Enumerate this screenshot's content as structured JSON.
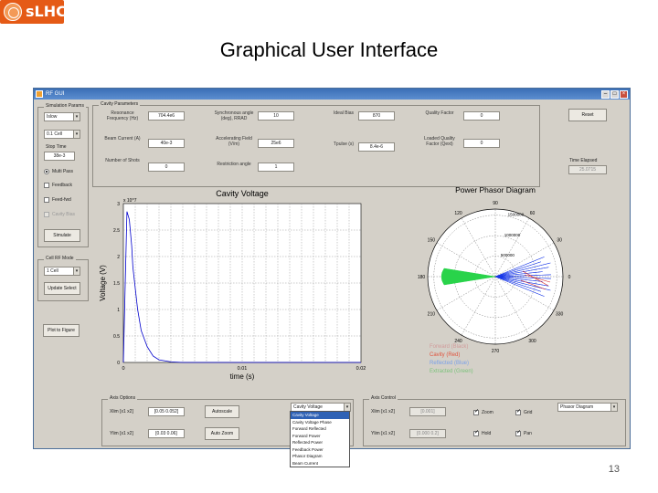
{
  "slide": {
    "logo_text": "sLHC",
    "title": "Graphical User Interface",
    "page_number": "13"
  },
  "window": {
    "title": "RF GUI",
    "sim_params_title": "Simulation Params",
    "sim_select_1": "Islow",
    "sim_select_2": "0.1 Cell",
    "stop_time_label": "Stop Time",
    "stop_time_value": "38e-3",
    "radio_label": "Multi Pass",
    "feedback_label": "Feedback",
    "feedforward_label": "Feed-fwd",
    "disabled_label": "Cavity Bias",
    "simulate_button": "Simulate",
    "cavity_params_title": "Cavity Parameters",
    "fields": [
      {
        "label": "Resonance Frequency (Hz)",
        "value": "704.4e6"
      },
      {
        "label": "Synchronous angle (deg), RRAD",
        "value": "10"
      },
      {
        "label": "Ideal Bias",
        "value": "870"
      },
      {
        "label": "Quality Factor",
        "value": "0"
      },
      {
        "label": "Beam Current (A)",
        "value": "40e-3"
      },
      {
        "label": "Accelerating Field (V/m)",
        "value": "25e6"
      },
      {
        "label": "Tpulse (s)",
        "value": "8.4e-6"
      },
      {
        "label": "Loaded Quality Factor (Qext)",
        "value": "0"
      },
      {
        "label": "Number of Shots",
        "value": "0"
      },
      {
        "label": "Restriction angle",
        "value": "1"
      }
    ],
    "reset_button": "Reset",
    "time_elapsed_label": "Time Elapsed",
    "time_elapsed_value": "25.0715",
    "cell_title": "Cell RF Mode",
    "cell_select": "1 Cell",
    "update_button": "Update Select",
    "plot_button": "Plot to Figure",
    "axes_title": "Axis Options",
    "xaxis_label": "Xlim [x1 x2]",
    "xaxis_value": "[0.05 0.052]",
    "yaxis_label": "Ylim [x1 x2]",
    "yaxis_value": "[0.03 0.06]",
    "autoscale_button": "Autoscale",
    "autozoom_button": "Auto Zoom",
    "dropdown_value": "Cavity Voltage",
    "dropdown_options": [
      "Cavity Voltage",
      "Cavity Voltage Phase",
      "Forward Reflected",
      "Forward Power",
      "Reflected Power",
      "Feedback Power",
      "Phasor Diagram",
      "Beam Current"
    ],
    "axis_control_title": "Axis Control",
    "xctl_label": "Xlim [x1 x2]",
    "xctl_value": "[0.001]",
    "yctl_label": "Ylim [x1 x2]",
    "yctl_value": "[0.000 0.2]",
    "ctl_checks": [
      "Zoom",
      "Grid",
      "Hold",
      "Pan"
    ],
    "right_select": "Phasor Diagram"
  },
  "chart_data": [
    {
      "type": "line",
      "title": "Cavity Voltage",
      "xlabel": "time (s)",
      "ylabel": "Voltage (V)",
      "multiplier_label": "x 10^7",
      "xlim": [
        0,
        0.02
      ],
      "ylim": [
        0,
        3
      ],
      "x_ticks": [
        "0",
        "0.01",
        "0.02"
      ],
      "y_ticks": [
        "0",
        "0.5",
        "1",
        "1.5",
        "2",
        "2.5",
        "3"
      ],
      "grid": true,
      "series": [
        {
          "x": [
            0,
            0.0003,
            0.0005,
            0.0007,
            0.0008,
            0.001,
            0.0012,
            0.0015,
            0.002,
            0.0025,
            0.003,
            0.004,
            0.005,
            0.02
          ],
          "y": [
            0,
            2.85,
            2.7,
            2.2,
            1.8,
            1.4,
            1.0,
            0.6,
            0.3,
            0.12,
            0.05,
            0.01,
            0,
            0
          ]
        }
      ],
      "colors": {
        "line": "#0000cc",
        "grid": "#9a9a9a"
      }
    },
    {
      "type": "polar",
      "title": "Power Phasor Diagram",
      "radial_ticks": [
        "500000",
        "1000000",
        "1500000"
      ],
      "angle_ticks": [
        "0",
        "30",
        "60",
        "90",
        "120",
        "150",
        "180",
        "210",
        "240",
        "270",
        "300",
        "330"
      ],
      "legend": [
        {
          "label": "Forward (Black)",
          "color": "#d19a9a"
        },
        {
          "label": "Cavity (Red)",
          "color": "#e0533d"
        },
        {
          "label": "Reflected (Blue)",
          "color": "#7aa0e8"
        },
        {
          "label": "Extracted (Green)",
          "color": "#7ac27a"
        }
      ],
      "colors": {
        "blue": "#1636e8",
        "green": "#29d34a",
        "red": "#d62020"
      }
    }
  ]
}
